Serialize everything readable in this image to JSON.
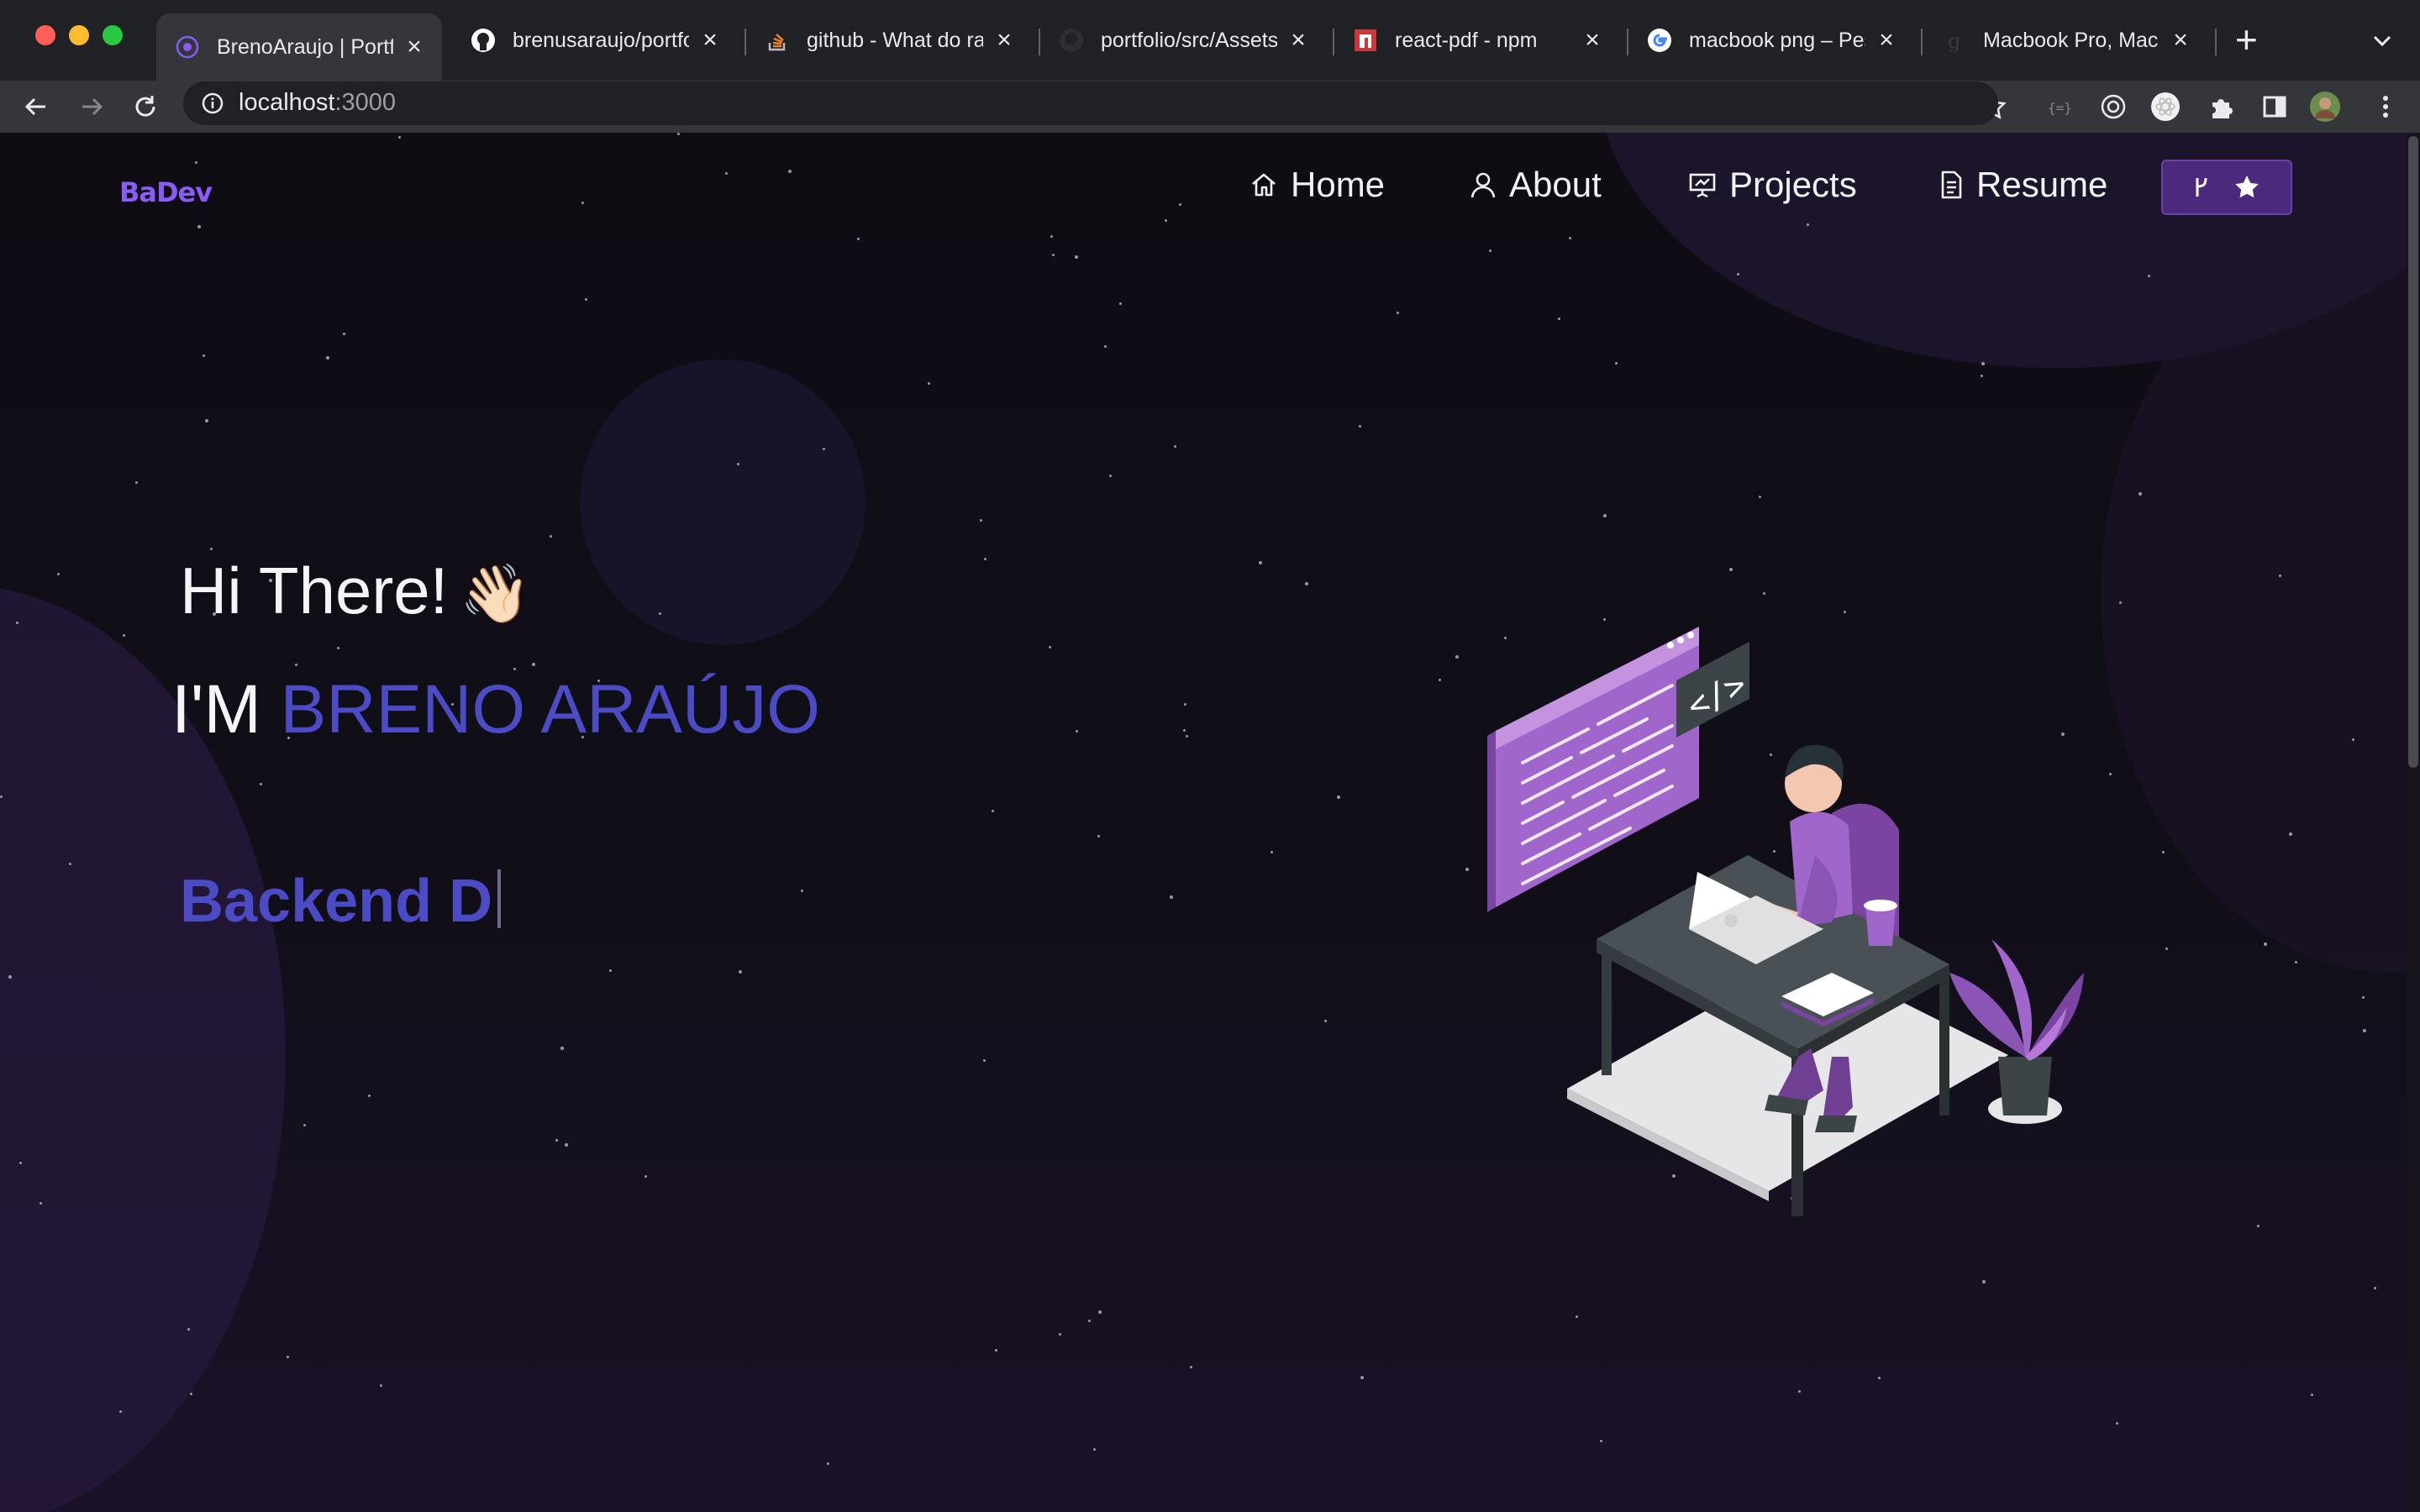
{
  "browser": {
    "tabs": [
      {
        "label": "BrenoAraujo | Portfo",
        "icon": "portfolio-favicon",
        "active": true
      },
      {
        "label": "brenusaraujo/portfo",
        "icon": "github-icon",
        "active": false
      },
      {
        "label": "github - What do ra",
        "icon": "stackoverflow-icon",
        "active": false
      },
      {
        "label": "portfolio/src/Assets",
        "icon": "github-icon",
        "active": false
      },
      {
        "label": "react-pdf - npm",
        "icon": "npm-icon",
        "active": false
      },
      {
        "label": "macbook png – Pes",
        "icon": "google-icon",
        "active": false
      },
      {
        "label": "Macbook Pro, Macb",
        "icon": "site-favicon",
        "active": false
      }
    ],
    "close_glyph": "×",
    "new_tab_glyph": "+",
    "url_host": "localhost",
    "url_port": ":3000"
  },
  "navbar": {
    "logo": "BaDev",
    "items": [
      {
        "label": "Home",
        "icon": "home-icon"
      },
      {
        "label": "About",
        "icon": "user-icon"
      },
      {
        "label": "Projects",
        "icon": "presentation-icon"
      },
      {
        "label": "Resume",
        "icon": "document-icon"
      }
    ],
    "star_button_icons": [
      "fork-icon",
      "star-icon"
    ]
  },
  "hero": {
    "greeting": "Hi There!",
    "wave_emoji": "👋🏻",
    "intro": "I'M ",
    "name": "BRENO ARAÚJO",
    "typed_text": "Backend D"
  },
  "colors": {
    "accent": "#4b4bc5",
    "logo": "#8a5cf6",
    "button_bg": "#4b2a7d",
    "illustration_purple": "#a066cc"
  }
}
